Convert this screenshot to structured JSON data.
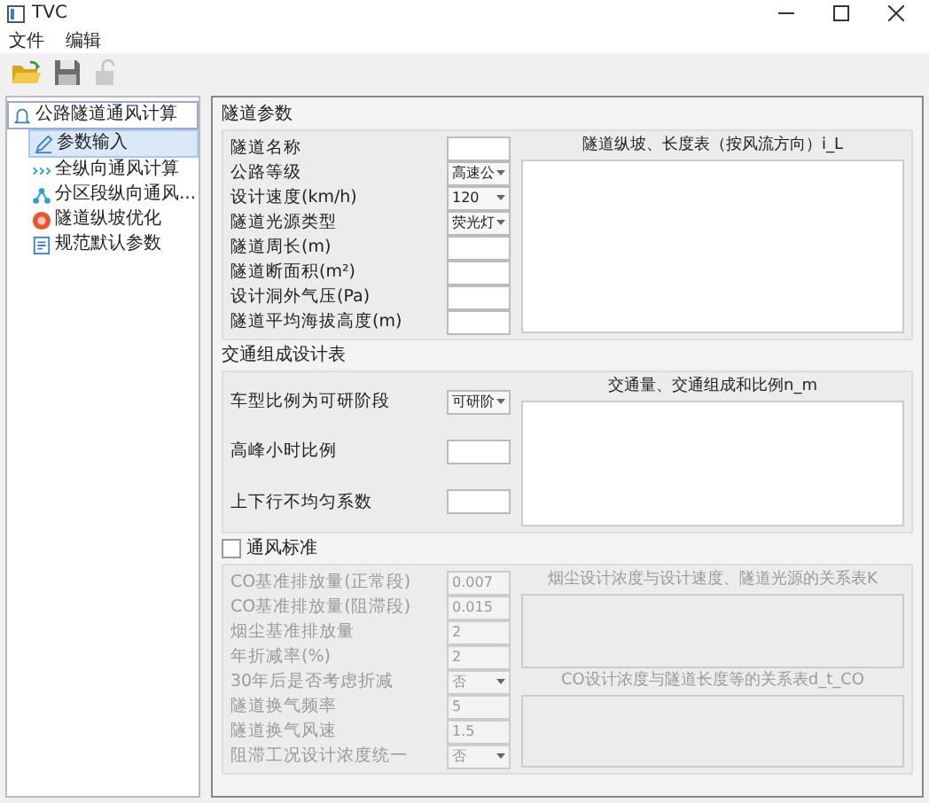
{
  "window": {
    "title": "TVC"
  },
  "menu": [
    "文件",
    "编辑"
  ],
  "toolbar": [
    {
      "kind": "open",
      "disabled": false
    },
    {
      "kind": "save",
      "disabled": false
    },
    {
      "kind": "lock",
      "disabled": true
    }
  ],
  "tree": {
    "label": "公路隧道通风计算",
    "children": [
      {
        "label": "参数输入",
        "kind": "pencil",
        "selected": true
      },
      {
        "label": "全纵向通风计算",
        "kind": "arrows",
        "selected": false
      },
      {
        "label": "分区段纵向通风...",
        "kind": "nodes",
        "selected": false
      },
      {
        "label": "隧道纵坡优化",
        "kind": "target",
        "selected": false
      },
      {
        "label": "规范默认参数",
        "kind": "doc",
        "selected": false
      }
    ]
  },
  "sections": [
    {
      "title": "隧道参数",
      "kind": "compact",
      "fields": [
        {
          "label": "隧道名称",
          "kind": "input"
        },
        {
          "label": "公路等级",
          "kind": "select",
          "value": "高速公"
        },
        {
          "label": "设计速度(km/h)",
          "kind": "select",
          "value": "120"
        },
        {
          "label": "隧道光源类型",
          "kind": "select",
          "value": "荧光灯"
        },
        {
          "label": "隧道周长(m)",
          "kind": "input"
        },
        {
          "label": "隧道断面积(m²)",
          "kind": "input"
        },
        {
          "label": "设计洞外气压(Pa)",
          "kind": "input"
        },
        {
          "label": "隧道平均海拔高度(m)",
          "kind": "input"
        }
      ],
      "tables": [
        {
          "title": "隧道纵坡、长度表（按风流方向）i_L"
        }
      ]
    },
    {
      "title": "交通组成设计表",
      "kind": "spread",
      "fields": [
        {
          "label": "车型比例为可研阶段",
          "kind": "select",
          "value": "可研阶"
        },
        {
          "label": "高峰小时比例",
          "kind": "input"
        },
        {
          "label": "上下行不均匀系数",
          "kind": "input"
        }
      ],
      "tables": [
        {
          "title": "交通量、交通组成和比例n_m"
        }
      ]
    },
    {
      "title": "通风标准",
      "kind": "compact",
      "checkbox": {
        "checked": false
      },
      "fields": [
        {
          "label": "CO基准排放量(正常段)",
          "kind": "input",
          "value": "0.007"
        },
        {
          "label": "CO基准排放量(阻滞段)",
          "kind": "input",
          "value": "0.015"
        },
        {
          "label": "烟尘基准排放量",
          "kind": "input",
          "value": "2"
        },
        {
          "label": "年折减率(%)",
          "kind": "input",
          "value": "2"
        },
        {
          "label": "30年后是否考虑折减",
          "kind": "select",
          "value": "否"
        },
        {
          "label": "隧道换气频率",
          "kind": "input",
          "value": "5"
        },
        {
          "label": "隧道换气风速",
          "kind": "input",
          "value": "1.5"
        },
        {
          "label": "阻滞工况设计浓度统一",
          "kind": "select",
          "value": "否"
        }
      ],
      "tables": [
        {
          "title": "烟尘设计浓度与设计速度、隧道光源的关系表K"
        },
        {
          "title": "CO设计浓度与隧道长度等的关系表d_t_CO"
        }
      ]
    }
  ]
}
